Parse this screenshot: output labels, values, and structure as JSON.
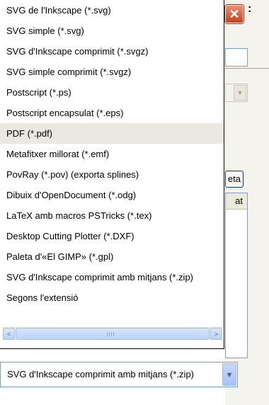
{
  "dialog": {
    "close_glyph": "✕",
    "title_fragment": ":",
    "button_fragment": "eta",
    "table_header_fragment": "at"
  },
  "dropdown": {
    "options": [
      "SVG de l'Inkscape (*.svg)",
      "SVG simple (*.svg)",
      "SVG d'Inkscape comprimit (*.svgz)",
      "SVG simple comprimit (*.svgz)",
      "Postscript (*.ps)",
      "Postscript encapsulat (*.eps)",
      "PDF (*.pdf)",
      "Metafitxer millorat (*.emf)",
      "PovRay (*.pov) (exporta splines)",
      "Dibuix d'OpenDocument (*.odg)",
      "LaTeX amb macros PSTricks (*.tex)",
      "Desktop Cutting Plotter (*.DXF)",
      "Paleta d'«El GIMP» (*.gpl)",
      "SVG d'Inkscape comprimit amb mitjans (*.zip)",
      "Segons l'extensió"
    ],
    "highlighted_index": 6,
    "scroll_left_glyph": "<",
    "scroll_right_glyph": ">"
  },
  "combo": {
    "selected_value": "SVG d'Inkscape comprimit amb mitjans (*.zip)",
    "arrow_glyph": "▼"
  },
  "colors": {
    "highlight": "#ebe8e1",
    "close_button": "#c8401c",
    "scroll_blue": "#b9d1f7"
  }
}
